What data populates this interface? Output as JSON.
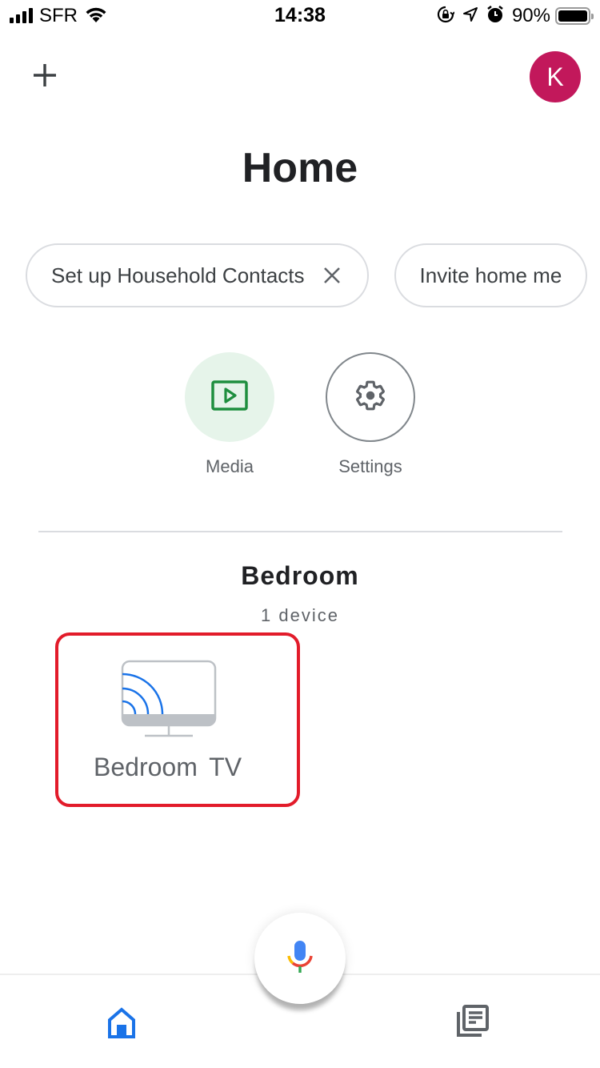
{
  "status_bar": {
    "carrier": "SFR",
    "time": "14:38",
    "battery_percent": "90%",
    "battery_level": 0.9,
    "icons": [
      "signal-icon",
      "wifi-icon",
      "rotation-lock-icon",
      "location-icon",
      "alarm-icon",
      "battery-icon"
    ]
  },
  "header": {
    "add_icon": "plus-icon",
    "avatar_initial": "K",
    "avatar_color": "#c2185b",
    "title": "Home"
  },
  "chips": [
    {
      "label": "Set up Household Contacts",
      "dismissible": true
    },
    {
      "label": "Invite home me",
      "dismissible": false
    }
  ],
  "actions": [
    {
      "label": "Media",
      "icon": "media-play-icon",
      "accent": "#1e8e3e"
    },
    {
      "label": "Settings",
      "icon": "gear-icon",
      "accent": "#5f6368"
    }
  ],
  "room": {
    "name": "Bedroom",
    "device_count": "1 device",
    "devices": [
      {
        "label": "Bedroom TV",
        "icon": "cast-tv-icon",
        "highlighted": true,
        "highlight_color": "#e21b2a"
      }
    ]
  },
  "bottom_nav": {
    "items": [
      {
        "name": "home",
        "icon": "home-icon",
        "active": true,
        "color": "#1a73e8"
      },
      {
        "name": "feed",
        "icon": "feed-icon",
        "active": false,
        "color": "#5f6368"
      }
    ],
    "mic_icon": "google-mic-icon"
  }
}
